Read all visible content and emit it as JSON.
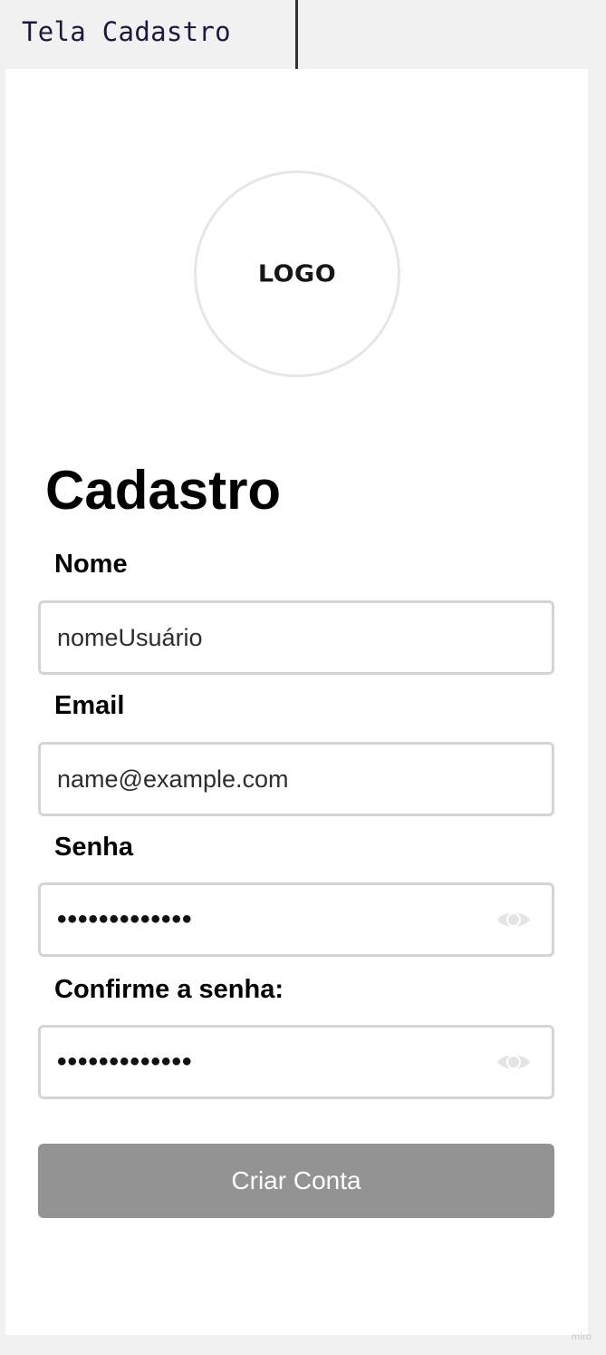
{
  "frame": {
    "title": "Tela Cadastro"
  },
  "logo": {
    "text": "LOGO"
  },
  "page": {
    "title": "Cadastro"
  },
  "form": {
    "name": {
      "label": "Nome",
      "value": "nomeUsuário"
    },
    "email": {
      "label": "Email",
      "value": "name@example.com"
    },
    "password": {
      "label": "Senha",
      "value": "•••••••••••••",
      "toggle_icon": "eye-icon"
    },
    "confirm_password": {
      "label": "Confirme a senha:",
      "value": "•••••••••••••",
      "toggle_icon": "eye-icon"
    },
    "submit_label": "Criar Conta"
  },
  "watermark": {
    "text": "miro"
  },
  "colors": {
    "button_bg": "#939393",
    "button_text": "#ffffff",
    "field_border": "#d4d4d4",
    "canvas_bg": "#f1f1f1",
    "frame_title": "#1b1a3d"
  }
}
